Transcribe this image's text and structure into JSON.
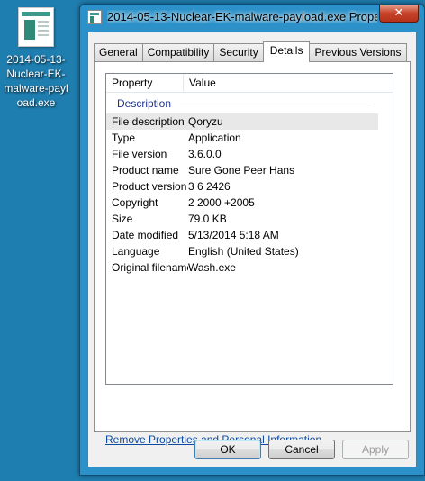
{
  "desktop": {
    "icon_label": "2014-05-13-Nuclear-EK-malware-payload.exe"
  },
  "window": {
    "title": "2014-05-13-Nuclear-EK-malware-payload.exe Proper...",
    "close_glyph": "✕"
  },
  "tabs": [
    {
      "label": "General",
      "active": false
    },
    {
      "label": "Compatibility",
      "active": false
    },
    {
      "label": "Security",
      "active": false
    },
    {
      "label": "Details",
      "active": true
    },
    {
      "label": "Previous Versions",
      "active": false
    }
  ],
  "list": {
    "headers": {
      "property": "Property",
      "value": "Value"
    },
    "group": "Description",
    "rows": [
      {
        "property": "File description",
        "value": "Qoryzu"
      },
      {
        "property": "Type",
        "value": "Application"
      },
      {
        "property": "File version",
        "value": "3.6.0.0"
      },
      {
        "property": "Product name",
        "value": "Sure Gone Peer Hans"
      },
      {
        "property": "Product version",
        "value": "3  6  2426"
      },
      {
        "property": "Copyright",
        "value": "2  2000  +2005"
      },
      {
        "property": "Size",
        "value": "79.0 KB"
      },
      {
        "property": "Date modified",
        "value": "5/13/2014 5:18 AM"
      },
      {
        "property": "Language",
        "value": "English (United States)"
      },
      {
        "property": "Original filename",
        "value": "Wash.exe"
      }
    ]
  },
  "remove_link": "Remove Properties and Personal Information",
  "buttons": {
    "ok": "OK",
    "cancel": "Cancel",
    "apply": "Apply"
  }
}
